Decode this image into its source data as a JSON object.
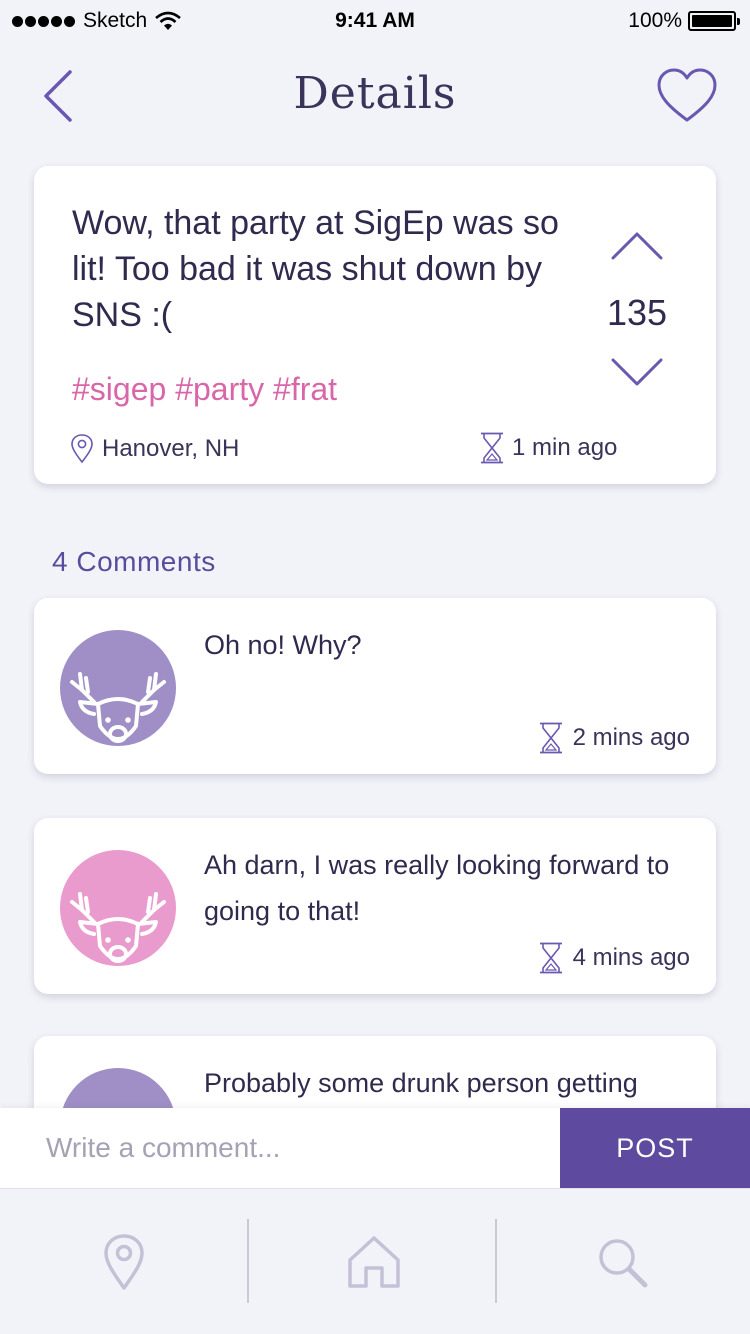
{
  "status_bar": {
    "carrier": "Sketch",
    "time": "9:41 AM",
    "battery": "100%"
  },
  "nav": {
    "title": "Details",
    "back_icon": "chevron-left-icon",
    "favorite_icon": "heart-icon"
  },
  "post": {
    "text": "Wow, that party at SigEp was so lit! Too bad it was shut down by SNS :(",
    "tags": "#sigep #party #frat",
    "location": "Hanover, NH",
    "time": "1 min ago",
    "votes": "135"
  },
  "comments_heading": "4 Comments",
  "comments": [
    {
      "text": "Oh no! Why?",
      "time": "2 mins ago",
      "avatar_color": "#9f8fc6",
      "avatar_icon": "deer-icon"
    },
    {
      "text": "Ah darn, I was really looking forward to going to that!",
      "time": "4 mins ago",
      "avatar_color": "#ea9bcd",
      "avatar_icon": "deer-icon"
    },
    {
      "text": "Probably some drunk person getting",
      "avatar_color": "#9f8fc6",
      "avatar_icon": "deer-icon"
    }
  ],
  "comment_input": {
    "placeholder": "Write a comment...",
    "post_label": "POST"
  },
  "tab_bar": {
    "items": [
      "location-pin-icon",
      "home-icon",
      "search-icon"
    ]
  },
  "colors": {
    "accent": "#5e4a9e",
    "tag": "#d966a8",
    "background": "#f2f3f8"
  }
}
